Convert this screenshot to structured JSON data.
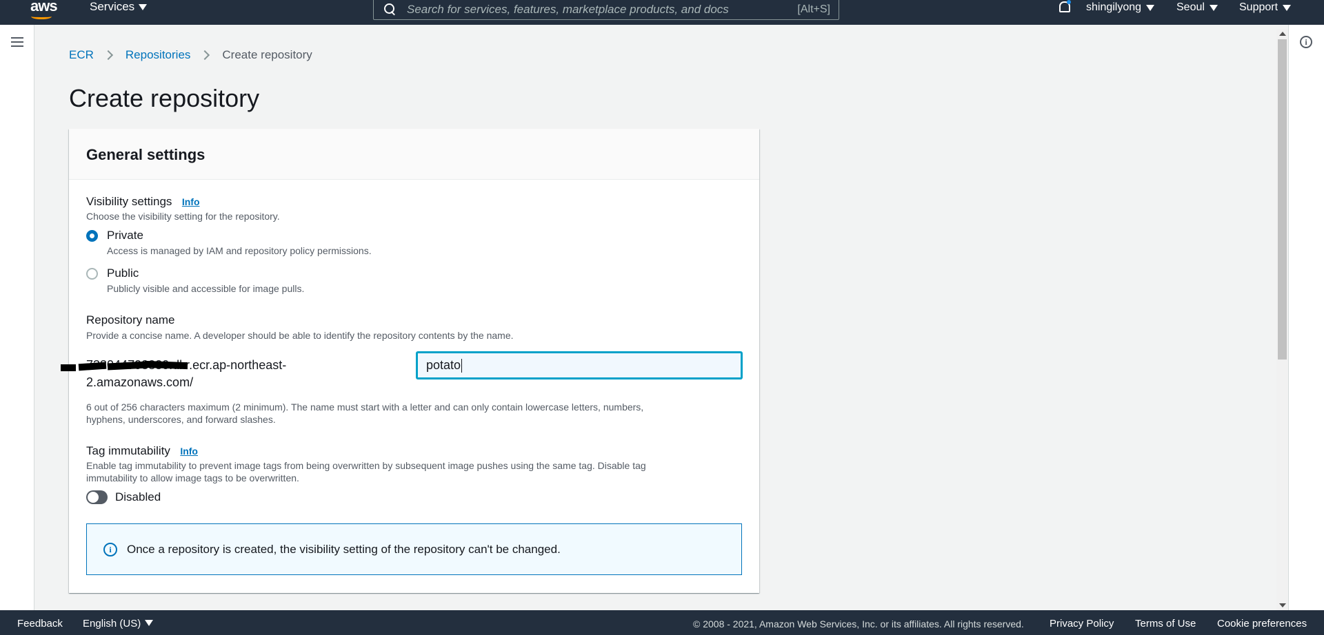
{
  "topnav": {
    "logo": "aws",
    "services_label": "Services",
    "search_placeholder": "Search for services, features, marketplace products, and docs",
    "search_shortcut": "[Alt+S]",
    "user": "shingilyong",
    "region": "Seoul",
    "support": "Support"
  },
  "breadcrumb": {
    "items": [
      "ECR",
      "Repositories"
    ],
    "current": "Create repository"
  },
  "page_title": "Create repository",
  "panel": {
    "title": "General settings",
    "visibility": {
      "label": "Visibility settings",
      "info": "Info",
      "description": "Choose the visibility setting for the repository.",
      "options": [
        {
          "label": "Private",
          "description": "Access is managed by IAM and repository policy permissions.",
          "checked": true
        },
        {
          "label": "Public",
          "description": "Publicly visible and accessible for image pulls.",
          "checked": false
        }
      ]
    },
    "repo_name": {
      "label": "Repository name",
      "description": "Provide a concise name. A developer should be able to identify the repository contents by the name.",
      "prefix_line1": "733044798830.dkr.ecr.ap-northeast-",
      "prefix_line2": "2.amazonaws.com/",
      "value": "potato",
      "constraint": "6 out of 256 characters maximum (2 minimum). The name must start with a letter and can only contain lowercase letters, numbers,",
      "constraint_line2": "hyphens, underscores, and forward slashes."
    },
    "tag_immutability": {
      "label": "Tag immutability",
      "info": "Info",
      "description_line1": "Enable tag immutability to prevent image tags from being overwritten by subsequent image pushes using the same tag. Disable tag",
      "description_line2": "immutability to allow image tags to be overwritten.",
      "toggle_label": "Disabled",
      "enabled": false
    },
    "alert": "Once a repository is created, the visibility setting of the repository can't be changed."
  },
  "footer": {
    "feedback": "Feedback",
    "language": "English (US)",
    "copyright": "© 2008 - 2021, Amazon Web Services, Inc. or its affiliates. All rights reserved.",
    "privacy": "Privacy Policy",
    "terms": "Terms of Use",
    "cookies": "Cookie preferences"
  },
  "colors": {
    "nav_bg": "#232f3e",
    "link": "#0073bb",
    "accent": "#ff9900",
    "focus": "#00a1c9"
  }
}
